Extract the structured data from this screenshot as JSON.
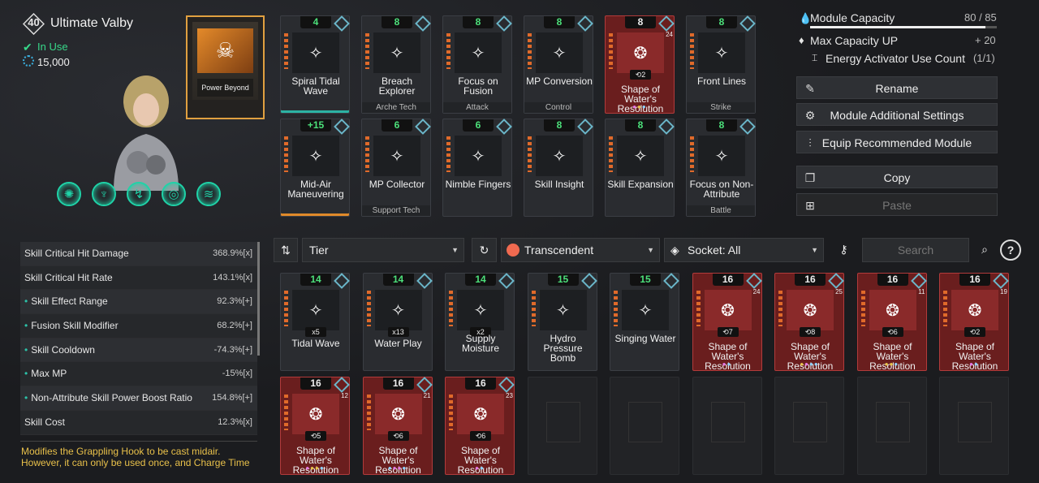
{
  "character": {
    "level": "40",
    "name": "Ultimate Valby",
    "status": "In Use",
    "cost": "15,000"
  },
  "power_beyond": {
    "label": "Power Beyond"
  },
  "equipped": [
    {
      "cap": "4",
      "name": "Spiral Tidal Wave",
      "tag": "",
      "red": false,
      "teal": true
    },
    {
      "cap": "8",
      "name": "Breach Explorer",
      "tag": "Arche Tech",
      "red": false
    },
    {
      "cap": "8",
      "name": "Focus on Fusion",
      "tag": "Attack",
      "red": false
    },
    {
      "cap": "8",
      "name": "MP Conversion",
      "tag": "Control",
      "red": false
    },
    {
      "cap": "8",
      "name": "Shape of Water's Resolution",
      "tag": "",
      "red": true,
      "num": "24",
      "count": "2",
      "dots": "#e678e6,#e8c44a,#8fd4ff"
    },
    {
      "cap": "8",
      "name": "Front Lines",
      "tag": "Strike",
      "red": false
    },
    {
      "cap": "+15",
      "name": "Mid-Air Maneuvering",
      "tag": "",
      "red": false,
      "orange": true
    },
    {
      "cap": "6",
      "name": "MP Collector",
      "tag": "Support Tech",
      "red": false
    },
    {
      "cap": "6",
      "name": "Nimble Fingers",
      "tag": "",
      "red": false
    },
    {
      "cap": "8",
      "name": "Skill Insight",
      "tag": "",
      "red": false
    },
    {
      "cap": "8",
      "name": "Skill Expansion",
      "tag": "",
      "red": false
    },
    {
      "cap": "8",
      "name": "Focus on Non-Attribute",
      "tag": "Battle",
      "red": false
    }
  ],
  "right": {
    "capacity_label": "Module Capacity",
    "capacity_value": "80 / 85",
    "capacity_fraction": 0.941,
    "max_up_label": "Max Capacity UP",
    "max_up_value": "+ 20",
    "eac_label": "Energy Activator Use Count",
    "eac_value": "(1/1)",
    "buttons": [
      "Rename",
      "Module Additional Settings",
      "Equip Recommended Module",
      "Copy",
      "Paste"
    ]
  },
  "filters": {
    "sort": "Tier",
    "tier": "Transcendent",
    "socket": "Socket: All",
    "search_placeholder": "Search"
  },
  "stats": [
    {
      "k": "Skill Critical Hit Damage",
      "v": "368.9%[x]",
      "b": false
    },
    {
      "k": "Skill Critical Hit Rate",
      "v": "143.1%[x]",
      "b": false
    },
    {
      "k": "Skill Effect Range",
      "v": "92.3%[+]",
      "b": true
    },
    {
      "k": "Fusion Skill Modifier",
      "v": "68.2%[+]",
      "b": true
    },
    {
      "k": "Skill Cooldown",
      "v": "-74.3%[+]",
      "b": true
    },
    {
      "k": "Max MP",
      "v": "-15%[x]",
      "b": true
    },
    {
      "k": "Non-Attribute Skill Power Boost Ratio",
      "v": "154.8%[+]",
      "b": true
    },
    {
      "k": "Skill Cost",
      "v": "12.3%[x]",
      "b": false
    }
  ],
  "description": "Modifies the Grappling Hook to be cast midair. However, it can only be used once, and Charge Time",
  "inventory": [
    {
      "cap": "14",
      "name": "Tidal Wave",
      "count": "x5",
      "red": false
    },
    {
      "cap": "14",
      "name": "Water Play",
      "count": "x13",
      "red": false
    },
    {
      "cap": "14",
      "name": "Supply Moisture",
      "count": "x2",
      "red": false
    },
    {
      "cap": "15",
      "name": "Hydro Pressure Bomb",
      "red": false
    },
    {
      "cap": "15",
      "name": "Singing Water",
      "red": false
    },
    {
      "cap": "16",
      "name": "Shape of Water's Resolution",
      "red": true,
      "num": "24",
      "count": "7",
      "dots": "#e678e6,#8fd4ff"
    },
    {
      "cap": "16",
      "name": "Shape of Water's Resolution",
      "red": true,
      "num": "25",
      "count": "8",
      "dots": "#e8c44a,#e678e6,#8fd4ff,#8fd4ff"
    },
    {
      "cap": "16",
      "name": "Shape of Water's Resolution",
      "red": true,
      "num": "11",
      "count": "6",
      "dots": "#e8c44a,#e8c44a,#8fd4ff"
    },
    {
      "cap": "16",
      "name": "Shape of Water's Resolution",
      "red": true,
      "num": "19",
      "count": "2",
      "dots": "#e678e6,#8fd4ff"
    },
    {
      "cap": "16",
      "name": "Shape of Water's Resolution",
      "red": true,
      "num": "12",
      "count": "5",
      "dots": "#e678e6,#e8c44a,#e8c44a,#8fd4ff"
    },
    {
      "cap": "16",
      "name": "Shape of Water's Resolution",
      "red": true,
      "num": "21",
      "count": "6",
      "dots": "#8fd4ff,#e678e6,#e678e6,#8fd4ff"
    },
    {
      "cap": "16",
      "name": "Shape of Water's Resolution",
      "red": true,
      "num": "23",
      "count": "6",
      "dots": "#e678e6,#8fd4ff"
    }
  ]
}
